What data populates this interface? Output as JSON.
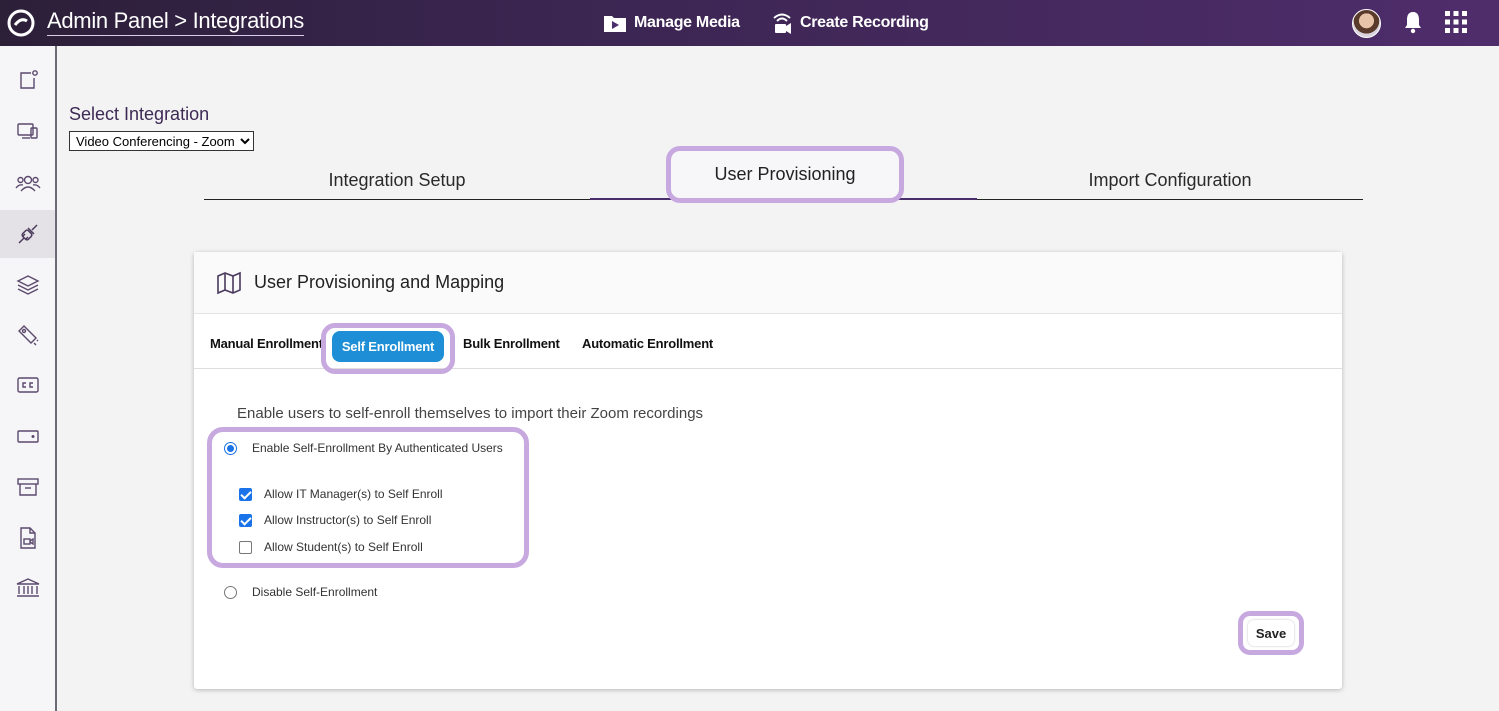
{
  "header": {
    "breadcrumb": "Admin Panel > Integrations",
    "manage_media": "Manage Media",
    "create_recording": "Create Recording",
    "icons": [
      "logo-icon",
      "media-folder-icon",
      "broadcast-camera-icon",
      "avatar",
      "bell-icon",
      "apps-grid-icon"
    ]
  },
  "sidebar": {
    "items": [
      {
        "icon": "new-item-icon"
      },
      {
        "icon": "devices-icon"
      },
      {
        "icon": "users-icon"
      },
      {
        "icon": "integrations-plug-icon",
        "active": true
      },
      {
        "icon": "layers-icon"
      },
      {
        "icon": "tag-icon"
      },
      {
        "icon": "closed-captions-icon"
      },
      {
        "icon": "wallet-icon"
      },
      {
        "icon": "archive-icon"
      },
      {
        "icon": "file-media-icon"
      },
      {
        "icon": "institution-icon"
      }
    ]
  },
  "integration": {
    "label": "Select Integration",
    "selected": "Video Conferencing - Zoom"
  },
  "tabs": [
    {
      "label": "Integration Setup"
    },
    {
      "label": "User Provisioning",
      "active": true
    },
    {
      "label": "Import Configuration"
    }
  ],
  "card": {
    "title": "User Provisioning and Mapping",
    "subtabs": [
      "Manual Enrollment",
      "Self Enrollment",
      "Bulk Enrollment",
      "Automatic Enrollment"
    ],
    "active_subtab": "Self Enrollment",
    "description": "Enable users to self-enroll themselves to import their Zoom recordings",
    "options": {
      "enable_label": "Enable Self-Enrollment By Authenticated Users",
      "enable_selected": true,
      "checks": [
        {
          "label": "Allow IT Manager(s) to Self Enroll",
          "checked": true
        },
        {
          "label": "Allow Instructor(s) to Self Enroll",
          "checked": true
        },
        {
          "label": "Allow Student(s) to Self Enroll",
          "checked": false
        }
      ],
      "disable_label": "Disable Self-Enrollment",
      "disable_selected": false
    },
    "save_label": "Save"
  },
  "colors": {
    "header_gradient_start": "#2c1f38",
    "header_gradient_end": "#4f2d6b",
    "highlight": "#c7a9e0",
    "active_subtab": "#1e8fd6",
    "control_blue": "#1a73e8"
  }
}
